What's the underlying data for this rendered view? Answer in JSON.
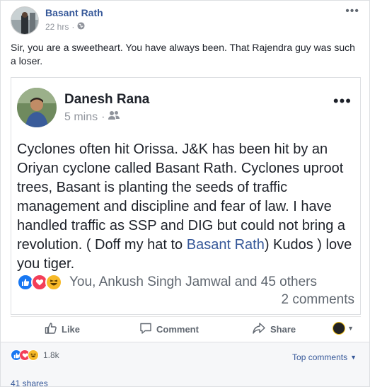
{
  "post": {
    "author": "Basant Rath",
    "time": "22 hrs",
    "text": "Sir, you are a sweetheart. You have always been. That Rajendra guy was such a loser."
  },
  "shared": {
    "author": "Danesh Rana",
    "time": "5 mins",
    "text_before_link": "Cyclones often hit Orissa. J&K has been hit by an Oriyan cyclone called Basant Rath. Cyclones uproot trees, Basant is planting the seeds of traffic management and discipline and fear of law. I have handled traffic as SSP and DIG but could not bring a revolution. ( Doff my hat to ",
    "link": "Basant Rath",
    "text_after_link": ") Kudos ) love you tiger.",
    "reactions_text": "You, Ankush Singh Jamwal and 45 others",
    "comments_text": "2 comments"
  },
  "actions": {
    "like": "Like",
    "comment": "Comment",
    "share": "Share"
  },
  "footer": {
    "reaction_count": "1.8k",
    "sort_label": "Top comments",
    "shares": "41 shares"
  },
  "colors": {
    "link": "#365899",
    "like": "#1877f2",
    "love": "#f33e58",
    "haha": "#f7b928"
  }
}
